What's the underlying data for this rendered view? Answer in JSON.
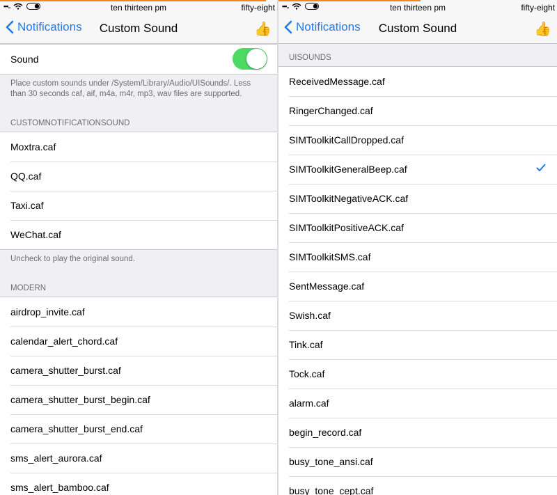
{
  "colors": {
    "accent": "#1a7cf5",
    "toggle_on": "#4cd964",
    "progress": "#f5841f"
  },
  "left": {
    "status": {
      "signal": "•••..",
      "time": "ten thirteen pm",
      "right": "fifty-eight"
    },
    "nav": {
      "back_label": "Notifications",
      "title": "Custom Sound",
      "right_icon": "thumbs-up-icon",
      "right_glyph": "👍"
    },
    "sound": {
      "label": "Sound",
      "enabled": true
    },
    "sound_footer": "Place custom sounds under /System/Library/Audio/UISounds/. Less than 30 seconds caf, aif, m4a, m4r, mp3, wav files are supported.",
    "custom_header": "CUSTOMNOTIFICATIONSOUND",
    "custom_items": [
      "Moxtra.caf",
      "QQ.caf",
      "Taxi.caf",
      "WeChat.caf"
    ],
    "custom_footer": "Uncheck to play the original sound.",
    "modern_header": "MODERN",
    "modern_items": [
      "airdrop_invite.caf",
      "calendar_alert_chord.caf",
      "camera_shutter_burst.caf",
      "camera_shutter_burst_begin.caf",
      "camera_shutter_burst_end.caf",
      "sms_alert_aurora.caf",
      "sms_alert_bamboo.caf"
    ]
  },
  "right": {
    "status": {
      "signal": "•••..",
      "time": "ten thirteen pm",
      "right": "fifty-eight"
    },
    "nav": {
      "back_label": "Notifications",
      "title": "Custom Sound",
      "right_icon": "thumbs-up-icon",
      "right_glyph": "👍"
    },
    "uisounds_header": "UISOUNDS",
    "items": [
      "ReceivedMessage.caf",
      "RingerChanged.caf",
      "SIMToolkitCallDropped.caf",
      "SIMToolkitGeneralBeep.caf",
      "SIMToolkitNegativeACK.caf",
      "SIMToolkitPositiveACK.caf",
      "SIMToolkitSMS.caf",
      "SentMessage.caf",
      "Swish.caf",
      "Tink.caf",
      "Tock.caf",
      "alarm.caf",
      "begin_record.caf",
      "busy_tone_ansi.caf",
      "busy_tone_cept.caf"
    ],
    "selected_index": 3
  }
}
